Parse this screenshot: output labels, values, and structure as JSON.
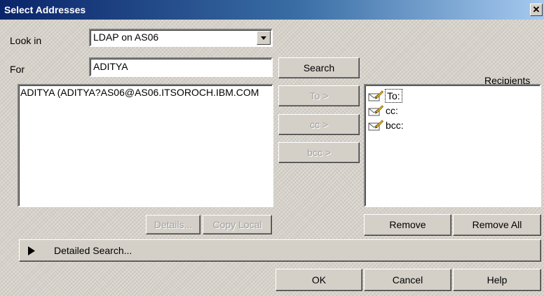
{
  "window": {
    "title": "Select Addresses",
    "close_glyph": "✕"
  },
  "look_in": {
    "label": "Look in",
    "value": "LDAP on AS06"
  },
  "for_field": {
    "label": "For",
    "value": "ADITYA"
  },
  "search_button": "Search",
  "results": {
    "items": [
      "ADITYA (ADITYA?AS06@AS06.ITSOROCH.IBM.COM"
    ]
  },
  "move_buttons": {
    "to": "To >",
    "cc": "cc >",
    "bcc": "bcc >"
  },
  "recipients": {
    "label": "Recipients",
    "items": [
      "To:",
      "cc:",
      "bcc:"
    ],
    "icon": "envelope-pencil-icon"
  },
  "details_button": "Details...",
  "copy_local_button": "Copy Local",
  "remove_button": "Remove",
  "remove_all_button": "Remove All",
  "detailed_search": {
    "label": "Detailed Search...",
    "icon": "expand-triangle-icon"
  },
  "footer": {
    "ok": "OK",
    "cancel": "Cancel",
    "help": "Help"
  }
}
